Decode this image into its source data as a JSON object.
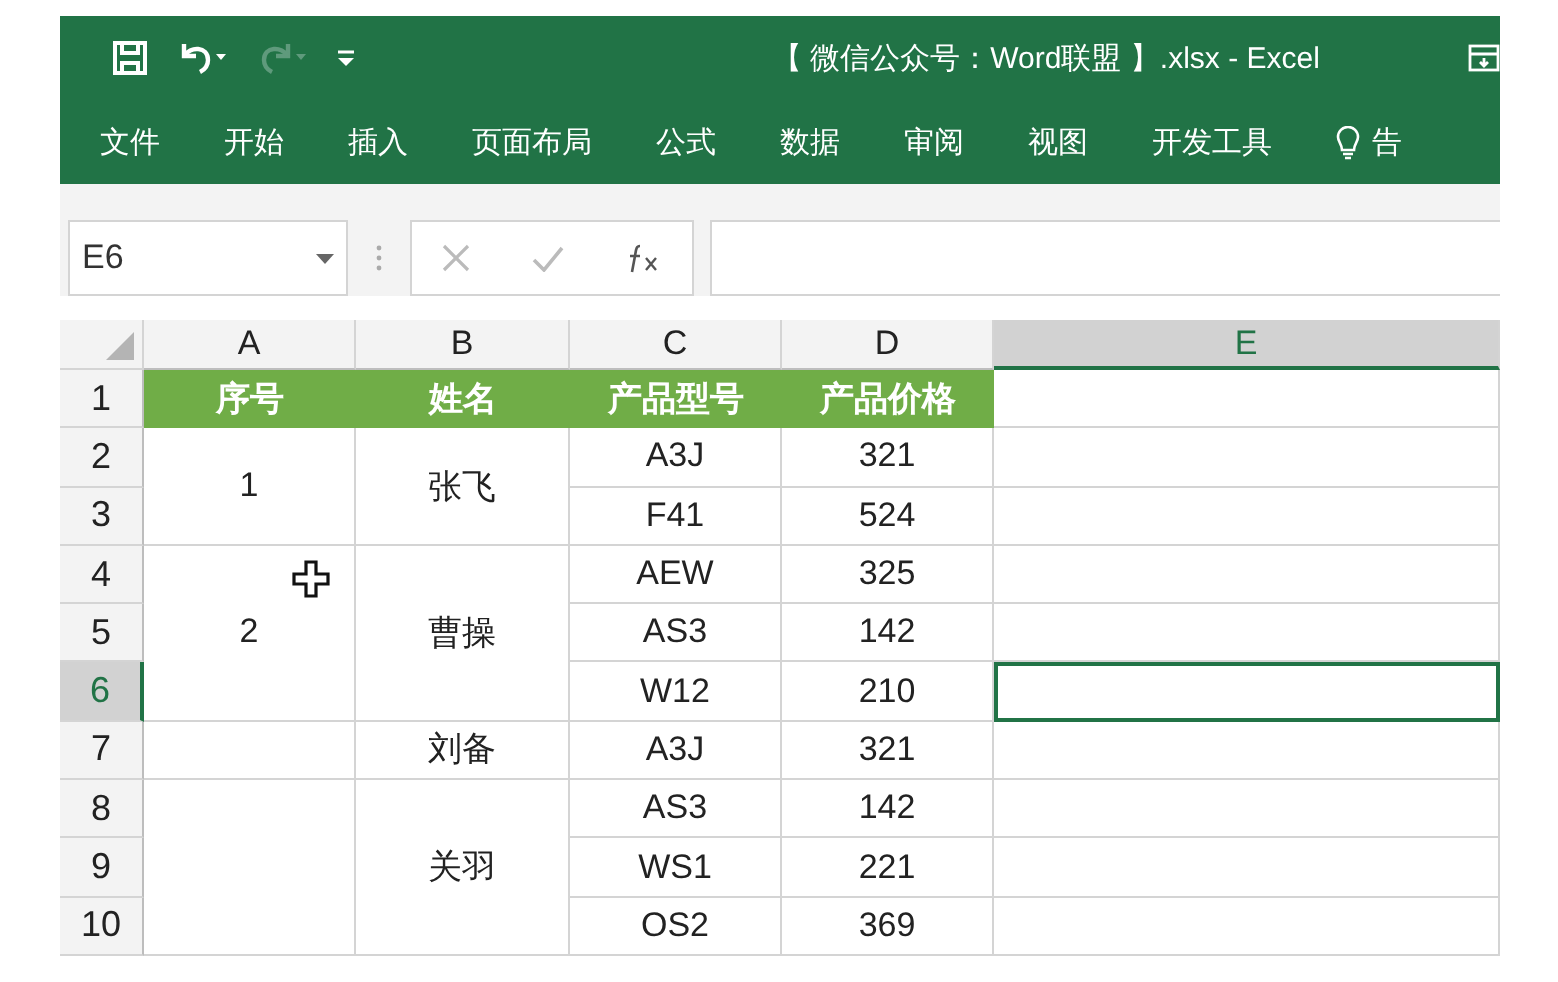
{
  "window": {
    "title": "【 微信公众号：Word联盟 】.xlsx - Excel"
  },
  "quick_access": [
    {
      "kind": "save",
      "disabled": false
    },
    {
      "kind": "undo",
      "disabled": false
    },
    {
      "kind": "redo",
      "disabled": true
    },
    {
      "kind": "customize",
      "disabled": false
    }
  ],
  "ribbon_tabs": [
    {
      "label": "文件"
    },
    {
      "label": "开始"
    },
    {
      "label": "插入"
    },
    {
      "label": "页面布局"
    },
    {
      "label": "公式"
    },
    {
      "label": "数据"
    },
    {
      "label": "审阅"
    },
    {
      "label": "视图"
    },
    {
      "label": "开发工具"
    },
    {
      "label": "告",
      "kind": "tell-me"
    }
  ],
  "formula_bar": {
    "name_box": "E6"
  },
  "sheet": {
    "column_headers": [
      {
        "label": "A",
        "selected": false
      },
      {
        "label": "B",
        "selected": false
      },
      {
        "label": "C",
        "selected": false
      },
      {
        "label": "D",
        "selected": false
      },
      {
        "label": "E",
        "selected": true
      }
    ],
    "row_headers": [
      {
        "label": "1",
        "selected": false
      },
      {
        "label": "2",
        "selected": false
      },
      {
        "label": "3",
        "selected": false
      },
      {
        "label": "4",
        "selected": false
      },
      {
        "label": "5",
        "selected": false
      },
      {
        "label": "6",
        "selected": true
      },
      {
        "label": "7",
        "selected": false
      },
      {
        "label": "8",
        "selected": false
      },
      {
        "label": "9",
        "selected": false
      },
      {
        "label": "10",
        "selected": false
      }
    ],
    "columns": [
      "序号",
      "姓名",
      "产品型号",
      "产品价格"
    ],
    "records": [
      {
        "seq": "1",
        "name": "张飞",
        "items": [
          {
            "model": "A3J",
            "price": "321"
          },
          {
            "model": "F41",
            "price": "524"
          }
        ]
      },
      {
        "seq": "2",
        "name": "曹操",
        "items": [
          {
            "model": "AEW",
            "price": "325"
          },
          {
            "model": "AS3",
            "price": "142"
          },
          {
            "model": "W12",
            "price": "210"
          }
        ]
      },
      {
        "name": "刘备",
        "items": [
          {
            "model": "A3J",
            "price": "321"
          }
        ]
      },
      {
        "name": "关羽",
        "items": [
          {
            "model": "AS3",
            "price": "142"
          },
          {
            "model": "WS1",
            "price": "221"
          },
          {
            "model": "OS2",
            "price": "369"
          }
        ]
      }
    ]
  }
}
